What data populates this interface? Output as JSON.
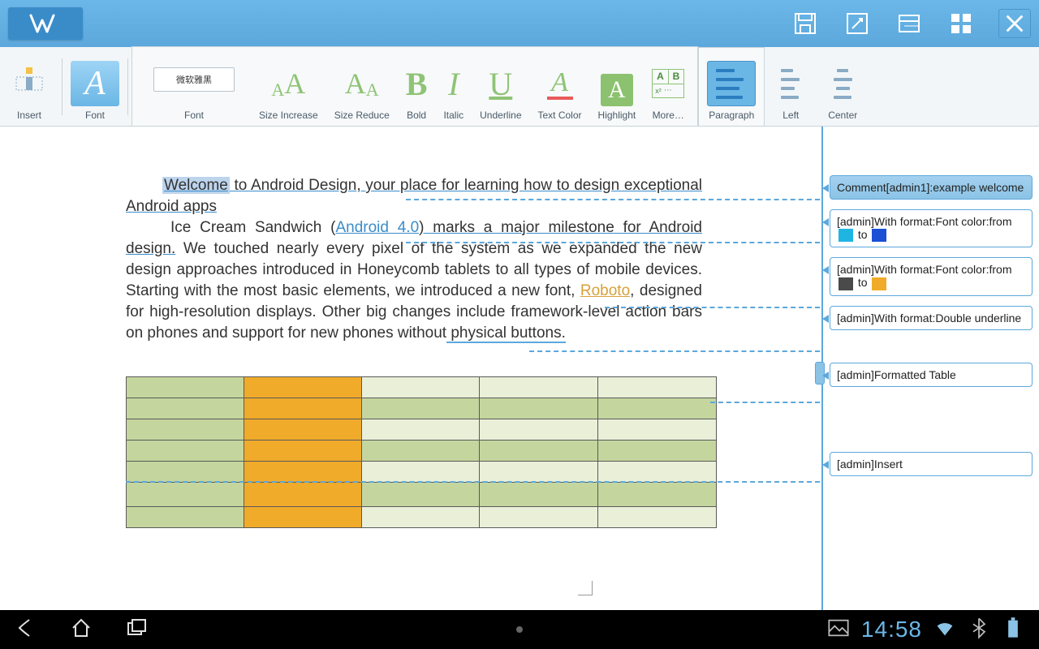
{
  "titlebar": {
    "app": "W"
  },
  "ribbon": {
    "insert": "Insert",
    "font_tab": "Font",
    "font_section": "Font",
    "font_name": "微软雅黑",
    "size_increase": "Size Increase",
    "size_reduce": "Size Reduce",
    "bold": "Bold",
    "italic": "Italic",
    "underline": "Underline",
    "text_color": "Text Color",
    "highlight": "Highlight",
    "more": "More…",
    "paragraph": "Paragraph",
    "left": "Left",
    "center": "Center"
  },
  "doc": {
    "p1_welcome": "Welcome",
    "p1_to": " to ",
    "p1_ad": "Android Design",
    "p1_rest": ", your place for learning how to design exceptional Android apps",
    "p2_a": "Ice Cream Sandwich (",
    "p2_link": "Android 4.0",
    "p2_b": ") marks a major milestone for Android design.",
    "p2_c": " We touched nearly every pixel of the system as we expanded the new design approaches introduced in Honeycomb tablets to all types of mobile devices. Starting with the most basic elements, we introduced a new font, ",
    "p2_roboto": "Roboto",
    "p2_d": ", designed for high-resolution displays. Other big changes include framework-level action bars on phones and support for new phones without",
    "p2_phys": " physical buttons."
  },
  "comments": [
    {
      "text": "Comment[admin1]:example welcome",
      "type": "comment"
    },
    {
      "text": "[admin]With format:Font color:from",
      "type": "format",
      "from": "#1fb5e3",
      "to": "#1a4fd6",
      "suffix": " to "
    },
    {
      "text": "[admin]With format:Font color:from",
      "type": "format",
      "from": "#4a4a4a",
      "to": "#f0ab2a",
      "suffix": " to "
    },
    {
      "text": "[admin]With format:Double underline",
      "type": "plain"
    },
    {
      "text": "[admin]Formatted Table",
      "type": "plain"
    },
    {
      "text": "[admin]Insert",
      "type": "plain"
    }
  ],
  "statusbar": {
    "time": "14:58"
  }
}
